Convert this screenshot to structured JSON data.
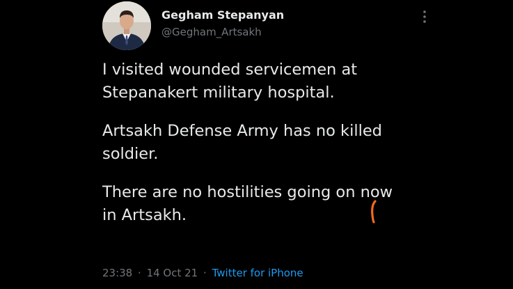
{
  "author": {
    "display_name": "Gegham Stepanyan",
    "handle": "@Gegham_Artsakh",
    "avatar_icon": "profile-photo-man-in-suit"
  },
  "more_icon": "vertical-ellipsis-icon",
  "tweet": {
    "paragraph_1_line_1": "I visited wounded servicemen at",
    "paragraph_1_line_2": "Stepanakert military hospital.",
    "paragraph_2_line_1": "Artsakh Defense Army has no killed",
    "paragraph_2_line_2": "soldier.",
    "paragraph_3_line_1": "There are no hostilities going on now",
    "paragraph_3_line_2": "in Artsakh."
  },
  "meta": {
    "time": "23:38",
    "separator": "·",
    "date": "14 Oct 21",
    "source": "Twitter for iPhone"
  },
  "colors": {
    "background": "#000000",
    "text": "#e7e9ea",
    "secondary_text": "#71767b",
    "link": "#1d9bf0",
    "annotation": "#f26a21"
  }
}
